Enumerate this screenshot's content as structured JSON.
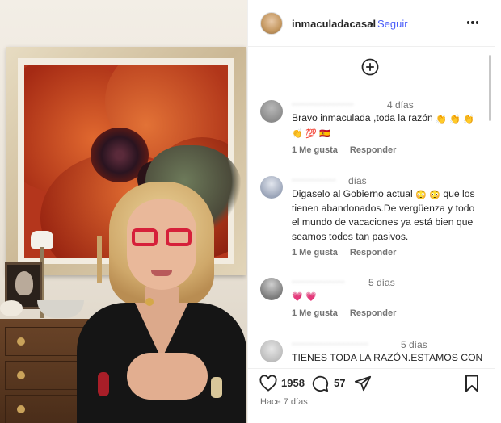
{
  "post": {
    "username": "inmaculadacasal",
    "separator": "•",
    "follow_label": "Seguir",
    "more_icon": "more-horizontal-icon"
  },
  "comments": [
    {
      "time": "4 días",
      "text": "Bravo inmaculada ,toda la razón",
      "emojis": [
        "👏",
        "👏",
        "👏",
        "👏",
        "💯",
        "🇪🇸"
      ],
      "likes_label": "1 Me gusta",
      "reply_label": "Responder"
    },
    {
      "time": "días",
      "text": "Digaselo al Gobierno actual",
      "emojis_inline": [
        "😳",
        "😳"
      ],
      "text_continued": "que los tienen abandonados.De vergüenza y todo el mundo de vacaciones ya está bien que seamos todos tan pasivos.",
      "likes_label": "1 Me gusta",
      "reply_label": "Responder"
    },
    {
      "time": "5 días",
      "emojis": [
        "💗",
        "💗"
      ],
      "likes_label": "1 Me gusta",
      "reply_label": "Responder"
    },
    {
      "time": "5 días",
      "text": "TIENES TODA LA RAZÓN.ESTAMOS CON"
    }
  ],
  "footer": {
    "likes_count": "1958",
    "comments_count": "57",
    "posted_ago": "Hace 7 días"
  },
  "colors": {
    "link_blue": "#4a5df9",
    "text": "#262626",
    "muted": "#737373"
  }
}
